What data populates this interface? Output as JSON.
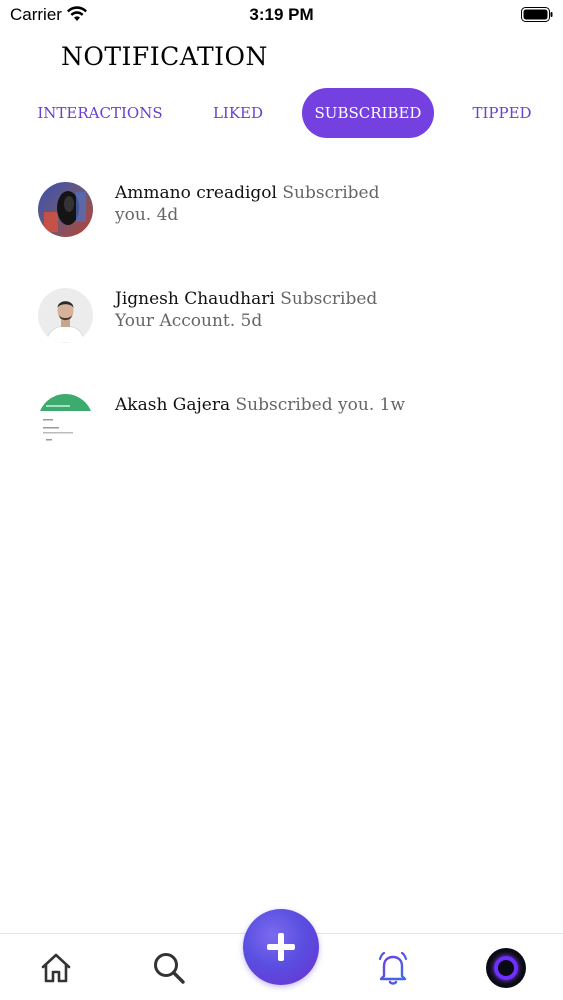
{
  "status_bar": {
    "carrier": "Carrier",
    "time": "3:19 PM"
  },
  "header": {
    "title": "NOTIFICATION"
  },
  "tabs": [
    {
      "label": "INTERACTIONS",
      "active": false
    },
    {
      "label": "LIKED",
      "active": false
    },
    {
      "label": "SUBSCRIBED",
      "active": true
    },
    {
      "label": "TIPPED",
      "active": false
    }
  ],
  "notifications": [
    {
      "name": "Ammano creadigol",
      "action": "Subscribed you. 4d"
    },
    {
      "name": "Jignesh Chaudhari",
      "action": "Subscribed Your Account. 5d"
    },
    {
      "name": "Akash Gajera",
      "action": "Subscribed you. 1w"
    }
  ],
  "bottom_nav": {
    "items": [
      "home-icon",
      "search-icon",
      "add-icon",
      "bell-icon",
      "profile-avatar"
    ]
  },
  "colors": {
    "accent": "#7440e0",
    "tab_text": "#6a3fd1",
    "secondary_text": "#666666"
  }
}
